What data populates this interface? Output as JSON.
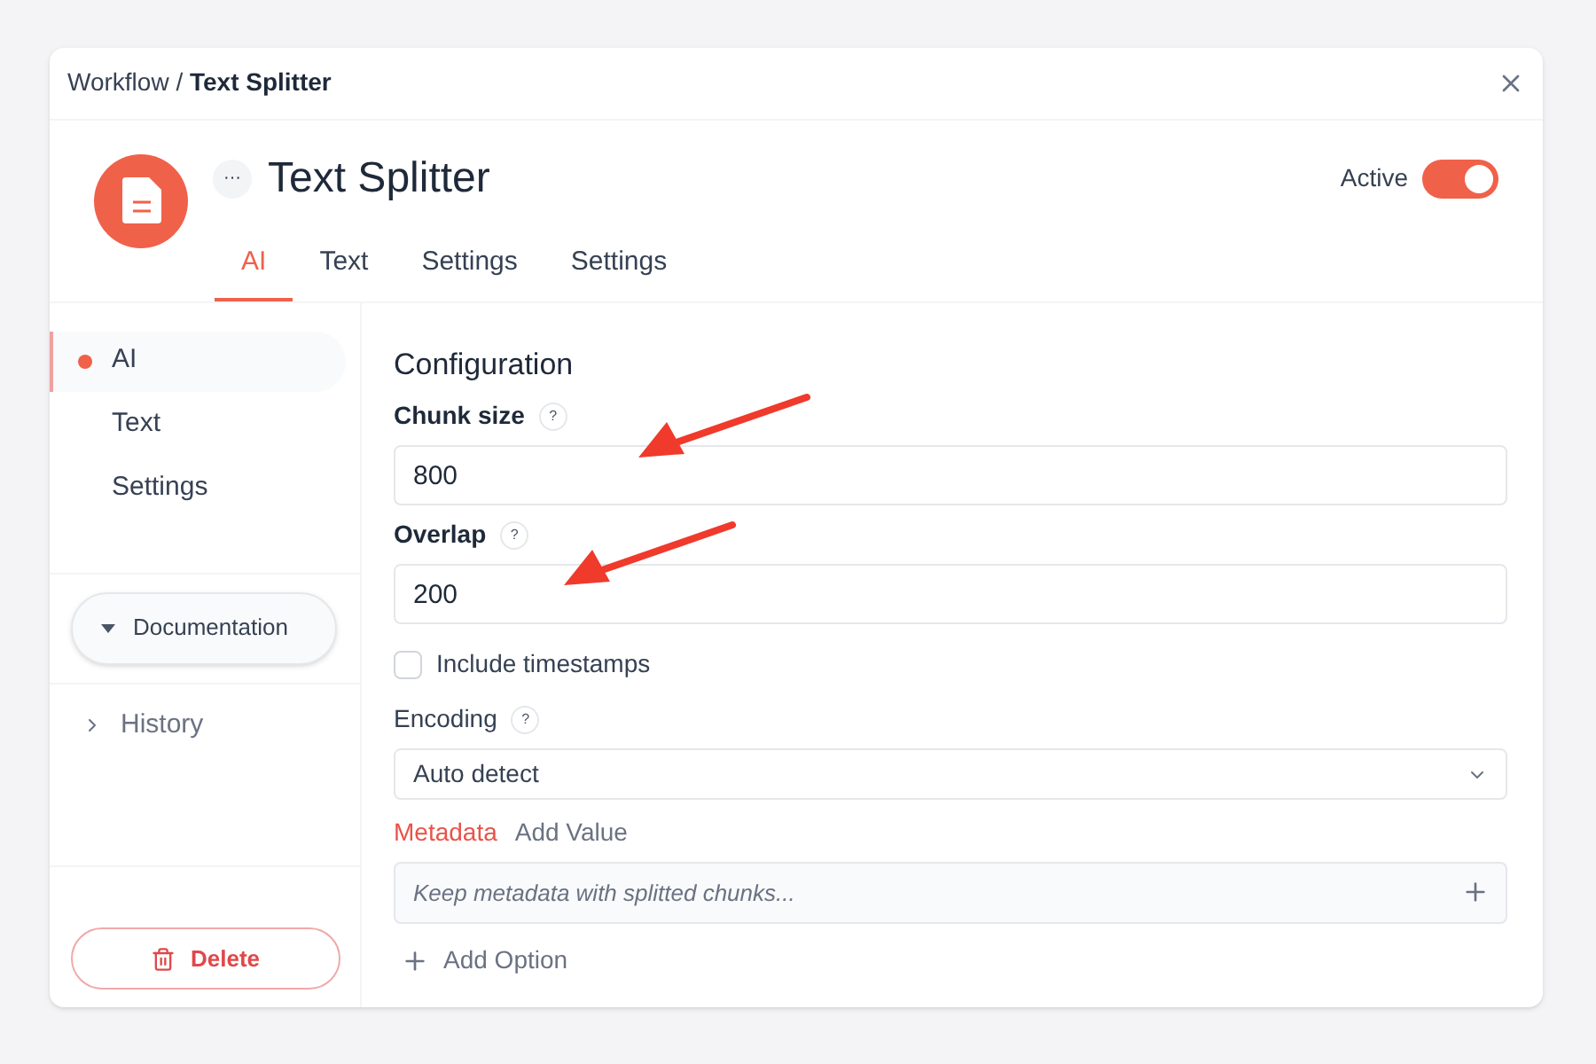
{
  "breadcrumb": {
    "parent": "Workflow",
    "separator": "/",
    "current": "Text Splitter"
  },
  "header": {
    "more": "···",
    "title": "Text Splitter",
    "active_label": "Active",
    "active": true
  },
  "tabs": [
    {
      "label": "AI",
      "selected": true
    },
    {
      "label": "Text",
      "selected": false
    },
    {
      "label": "Settings",
      "selected": false
    },
    {
      "label": "Settings",
      "selected": false
    }
  ],
  "sidebar": {
    "items": [
      {
        "label": "AI",
        "selected": true
      },
      {
        "label": "Text",
        "selected": false
      },
      {
        "label": "Settings",
        "selected": false
      }
    ],
    "sections": [
      {
        "label": "Documentation",
        "kind": "pill",
        "expanded": true
      },
      {
        "label": "History",
        "kind": "row",
        "expanded": false
      }
    ],
    "delete": "Delete"
  },
  "form": {
    "heading": "Configuration",
    "fields": [
      {
        "label": "Chunk size",
        "help": "?",
        "value": "800"
      },
      {
        "label": "Overlap",
        "help": "?",
        "value": "200"
      }
    ],
    "checkbox": {
      "label": "Include timestamps",
      "checked": false
    },
    "select": {
      "label": "Encoding",
      "help": "?",
      "value": "Auto detect"
    },
    "meta_tabs": [
      {
        "label": "Metadata",
        "selected": true
      },
      {
        "label": "Add Value",
        "selected": false
      }
    ],
    "meta_input": {
      "placeholder": "Keep metadata with splitted chunks..."
    },
    "add_option": "Add Option"
  }
}
